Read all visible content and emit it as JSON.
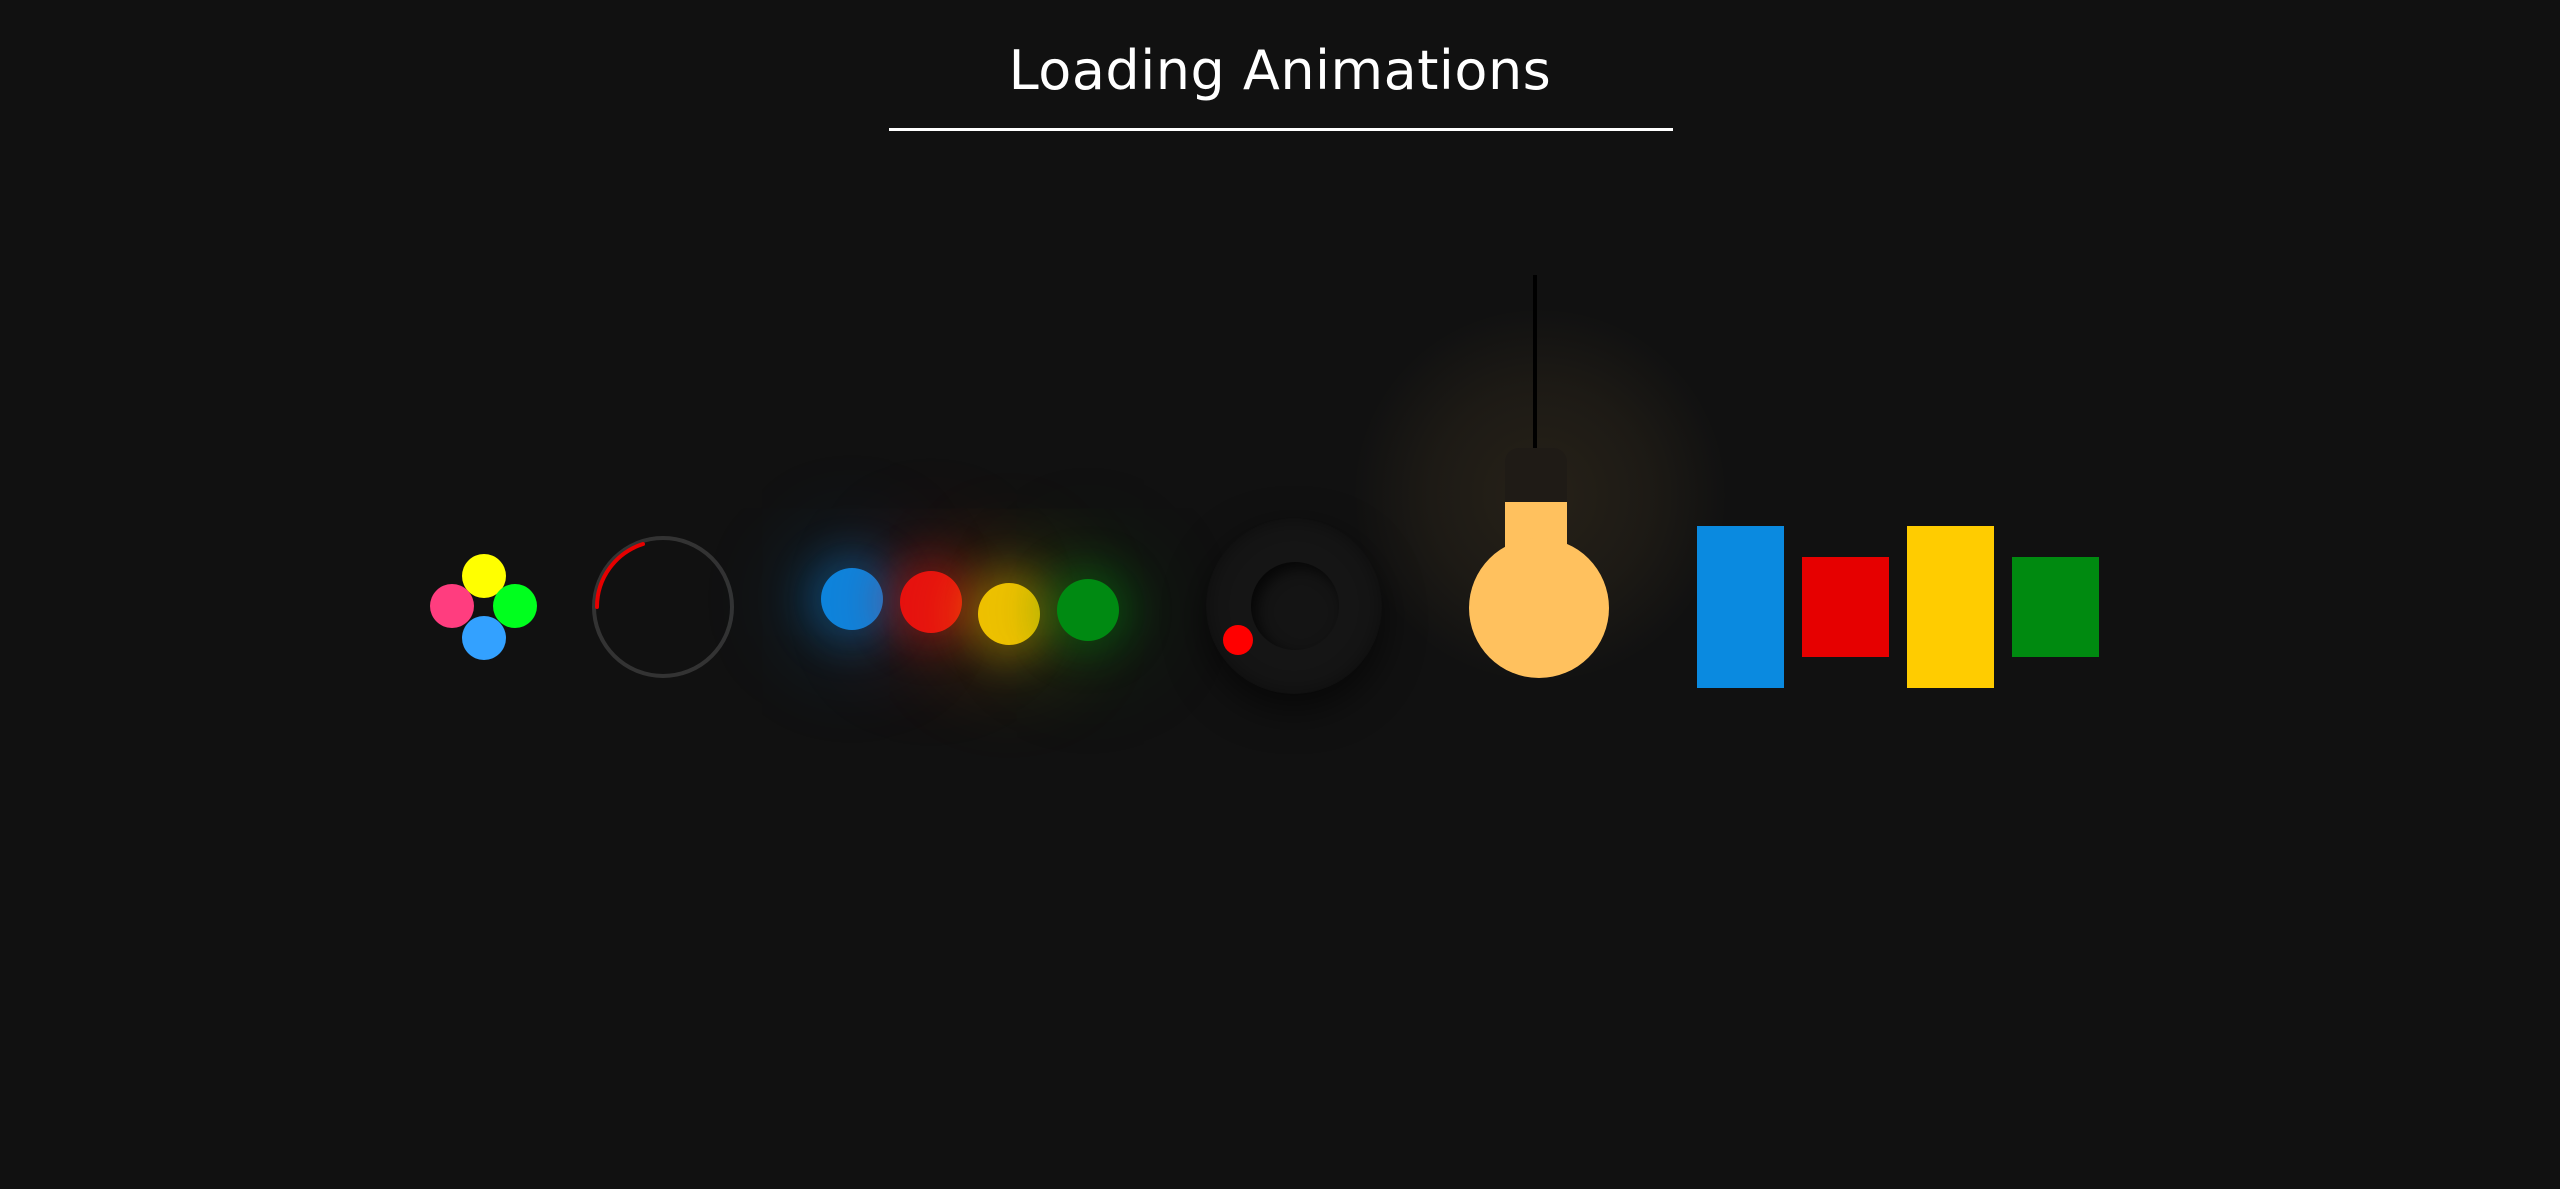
{
  "page": {
    "title": "Loading Animations",
    "background": "#111111"
  },
  "loaders": {
    "dot_cluster": {
      "colors": {
        "top": "#ffff00",
        "left": "#ff3d7f",
        "right": "#00ff1e",
        "bottom": "#33a1ff"
      }
    },
    "ring_spinner": {
      "track_color": "#333333",
      "arc_color": "#e60000"
    },
    "glow_dots": {
      "colors": [
        "#0a86e0",
        "#e60f0f",
        "#f2c200",
        "#008a12"
      ]
    },
    "orbit": {
      "dot_color": "#ff0000"
    },
    "light_bulb": {
      "bulb_color": "#ffc15e",
      "cap_color": "#1f1b16"
    },
    "bars": {
      "colors": [
        "#0a8ae0",
        "#e60000",
        "#ffcc00",
        "#008a10"
      ]
    }
  }
}
